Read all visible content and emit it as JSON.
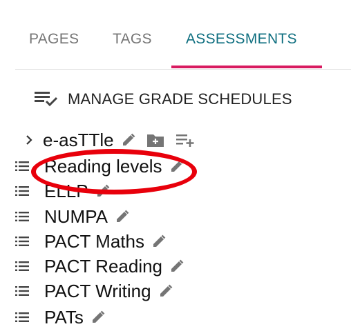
{
  "tabs": [
    {
      "label": "PAGES",
      "active": false
    },
    {
      "label": "TAGS",
      "active": false
    },
    {
      "label": "ASSESSMENTS",
      "active": true
    }
  ],
  "manage": {
    "label": "MANAGE GRADE SCHEDULES",
    "icon": "playlist-check-icon"
  },
  "items": [
    {
      "label": "e-asTTle",
      "has_children": true
    },
    {
      "label": "Reading levels"
    },
    {
      "label": "ELLP"
    },
    {
      "label": "NUMPA"
    },
    {
      "label": "PACT Maths"
    },
    {
      "label": "PACT Reading"
    },
    {
      "label": "PACT Writing"
    },
    {
      "label": "PATs"
    }
  ],
  "colors": {
    "active_tab": "#0f6f80",
    "underline": "#d81b60",
    "icon": "#757575",
    "annotation": "#e8000b"
  }
}
